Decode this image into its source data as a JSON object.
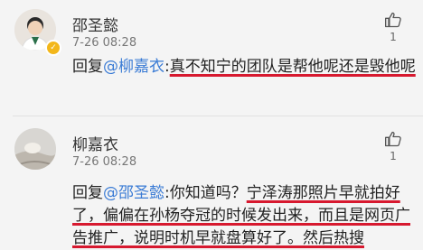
{
  "comments": [
    {
      "username": "邵圣懿",
      "timestamp": "7-26 08:28",
      "verified": true,
      "like_icon": "thumbs-up-icon",
      "like_count": "1",
      "reply_prefix": "回复",
      "mention": "@柳嘉衣",
      "body_plain": ":",
      "body_highlight": "真不知宁的团队是帮他呢还是毁他呢"
    },
    {
      "username": "柳嘉衣",
      "timestamp": "7-26 08:28",
      "verified": false,
      "like_icon": "thumbs-up-icon",
      "like_count": "1",
      "reply_prefix": "回复",
      "mention": "@邵圣懿",
      "body_plain": ":你知道吗？",
      "body_highlight": "宁泽涛那照片早就拍好了，偏偏在孙杨夺冠的时候发出来，而且是网页广告推广，说明时机早就盘算好了。然后热搜"
    }
  ],
  "colors": {
    "mention": "#3a7bd5",
    "highlight_underline": "#d7192f",
    "verified_badge": "#f3b71b"
  }
}
